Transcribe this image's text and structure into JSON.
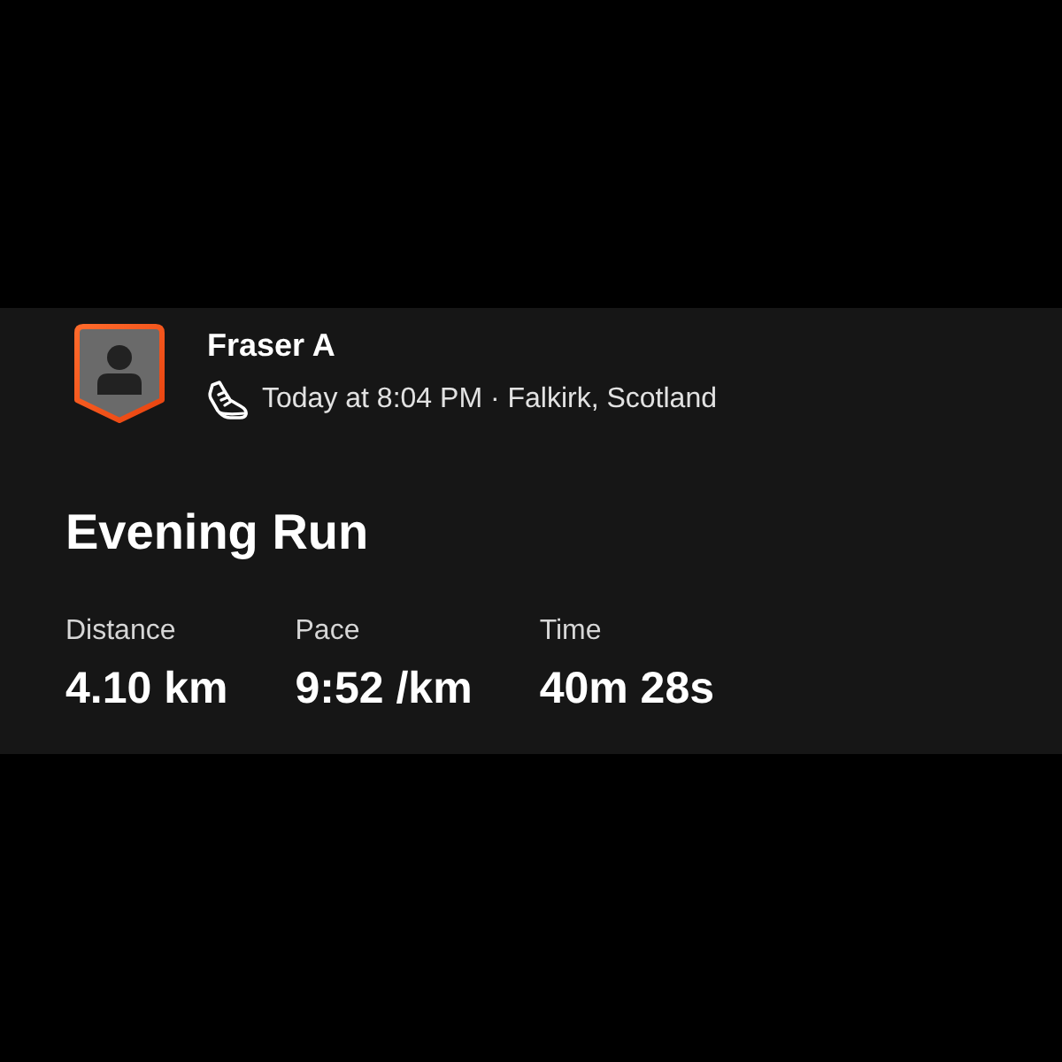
{
  "athlete": {
    "name": "Fraser A",
    "meta": "Today at 8:04 PM · Falkirk, Scotland"
  },
  "activity": {
    "title": "Evening Run"
  },
  "stats": [
    {
      "label": "Distance",
      "value": "4.10 km"
    },
    {
      "label": "Pace",
      "value": "9:52 /km"
    },
    {
      "label": "Time",
      "value": "40m 28s"
    }
  ]
}
